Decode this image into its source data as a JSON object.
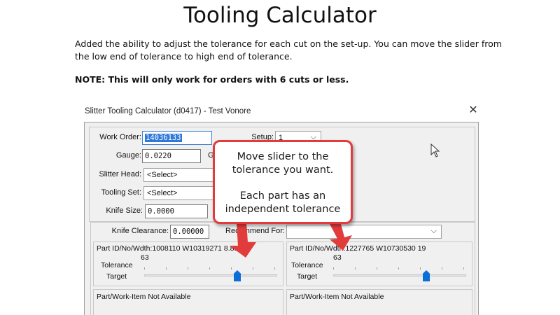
{
  "slide": {
    "title": "Tooling Calculator",
    "description": "Added the ability to adjust the tolerance for each cut on the set-up. You can move the slider from the low end of tolerance to high end of tolerance.",
    "note": "NOTE: This will only work for orders with 6 cuts or less."
  },
  "dialog": {
    "title": "Slitter Tooling Calculator (d0417) - Test Vonore",
    "work_order_label": "Work Order:",
    "work_order_value": "14036133",
    "setup_label": "Setup:",
    "setup_value": "1",
    "gauge_label": "Gauge:",
    "gauge_value": "0.0220",
    "gauge_suffix": "G",
    "slitter_head_label": "Slitter Head:",
    "slitter_head_value": "<Select>",
    "tooling_set_label": "Tooling Set:",
    "tooling_set_value": "<Select>",
    "knife_size_label": "Knife Size:",
    "knife_size_value": "0.0000",
    "knife_clearance_label": "Knife Clearance:",
    "knife_clearance_value": "0.00000",
    "recommend_for_label": "Recommend For:",
    "recommend_for_value": ""
  },
  "parts": [
    {
      "title": "Part ID/No/Wdth:1008110 W10319271 8.888",
      "tick_value": "63",
      "tolerance_label": "Tolerance",
      "target_label": "Target",
      "tolerance_position": 0.7
    },
    {
      "title": "Part ID/No/Wdth:1227765 W10730530 19",
      "tick_value": "63",
      "tolerance_label": "Tolerance",
      "target_label": "Target",
      "tolerance_position": 0.7
    }
  ],
  "unavailable": [
    {
      "label": "Part/Work-Item Not Available"
    },
    {
      "label": "Part/Work-Item Not Available"
    }
  ],
  "callout": {
    "line1": "Move slider to the",
    "line2": "tolerance you want.",
    "line3": "Each part has an",
    "line4": "independent tolerance"
  },
  "colors": {
    "callout_border": "#e23b3b",
    "arrow": "#e23b3b",
    "slider_thumb": "#0a6fd8",
    "selection": "#3078d8"
  },
  "icons": {
    "close": "close-icon",
    "chevron": "chevron-down-icon",
    "cursor": "mouse-pointer-icon"
  }
}
